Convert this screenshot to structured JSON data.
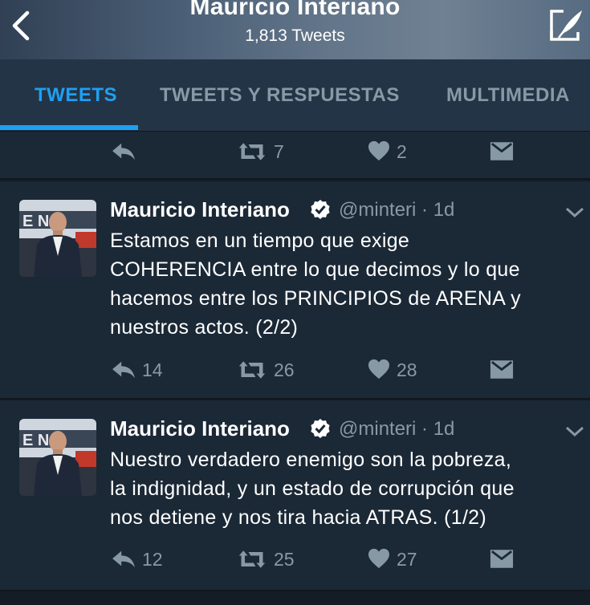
{
  "header": {
    "title": "Mauricio Interiano",
    "subtitle": "1,813 Tweets"
  },
  "tabs": [
    {
      "label": "TWEETS",
      "active": true
    },
    {
      "label": "TWEETS Y RESPUESTAS",
      "active": false
    },
    {
      "label": "MULTIMEDIA",
      "active": false
    }
  ],
  "colors": {
    "accent": "#1da1f2",
    "background": "#141d26",
    "card": "#1b2836",
    "muted": "#8899a6"
  },
  "partial_tweet": {
    "reply_count": "",
    "retweet_count": "7",
    "like_count": "2"
  },
  "tweets": [
    {
      "name": "Mauricio Interiano",
      "verified": true,
      "handle": "@minteri · 1d",
      "lines": [
        "Estamos en un tiempo que exige",
        "COHERENCIA entre lo que decimos y lo que",
        "hacemos entre los PRINCIPIOS de ARENA y",
        "nuestros actos. (2/2)"
      ],
      "reply_count": "14",
      "retweet_count": "26",
      "like_count": "28"
    },
    {
      "name": "Mauricio Interiano",
      "verified": true,
      "handle": "@minteri · 1d",
      "lines": [
        "Nuestro verdadero enemigo son la pobreza,",
        "la indignidad, y un estado de corrupción que",
        "nos detiene y nos tira hacia ATRAS. (1/2)"
      ],
      "reply_count": "12",
      "retweet_count": "25",
      "like_count": "27"
    }
  ],
  "icons": [
    "back-icon",
    "compose-icon",
    "verified-icon",
    "chevron-down-icon",
    "reply-icon",
    "retweet-icon",
    "like-icon",
    "direct-message-icon"
  ]
}
